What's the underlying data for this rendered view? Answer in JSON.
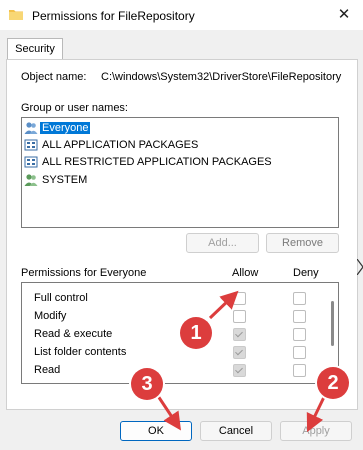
{
  "window": {
    "title": "Permissions for FileRepository",
    "close_symbol": "✕"
  },
  "tabs": [
    {
      "label": "Security"
    }
  ],
  "object": {
    "label": "Object name:",
    "value": "C:\\windows\\System32\\DriverStore\\FileRepository"
  },
  "groups": {
    "label": "Group or user names:",
    "items": [
      {
        "label": "Everyone",
        "icon": "users-icon",
        "selected": true
      },
      {
        "label": "ALL APPLICATION PACKAGES",
        "icon": "app-packages-icon",
        "selected": false
      },
      {
        "label": "ALL RESTRICTED APPLICATION PACKAGES",
        "icon": "app-packages-icon",
        "selected": false
      },
      {
        "label": "SYSTEM",
        "icon": "users-icon",
        "selected": false
      }
    ],
    "add_label": "Add...",
    "remove_label": "Remove"
  },
  "permissions": {
    "title": "Permissions for Everyone",
    "allow_label": "Allow",
    "deny_label": "Deny",
    "rows": [
      {
        "label": "Full control",
        "allow": false,
        "deny": false
      },
      {
        "label": "Modify",
        "allow": false,
        "deny": false
      },
      {
        "label": "Read & execute",
        "allow": true,
        "deny": false
      },
      {
        "label": "List folder contents",
        "allow": true,
        "deny": false
      },
      {
        "label": "Read",
        "allow": true,
        "deny": false
      }
    ]
  },
  "buttons": {
    "ok_label": "OK",
    "cancel_label": "Cancel",
    "apply_label": "Apply"
  },
  "annotations": [
    {
      "number": "1"
    },
    {
      "number": "2"
    },
    {
      "number": "3"
    }
  ],
  "colors": {
    "selection": "#0078d7",
    "callout": "#dc3d3d",
    "ok_border": "#0067c0"
  }
}
